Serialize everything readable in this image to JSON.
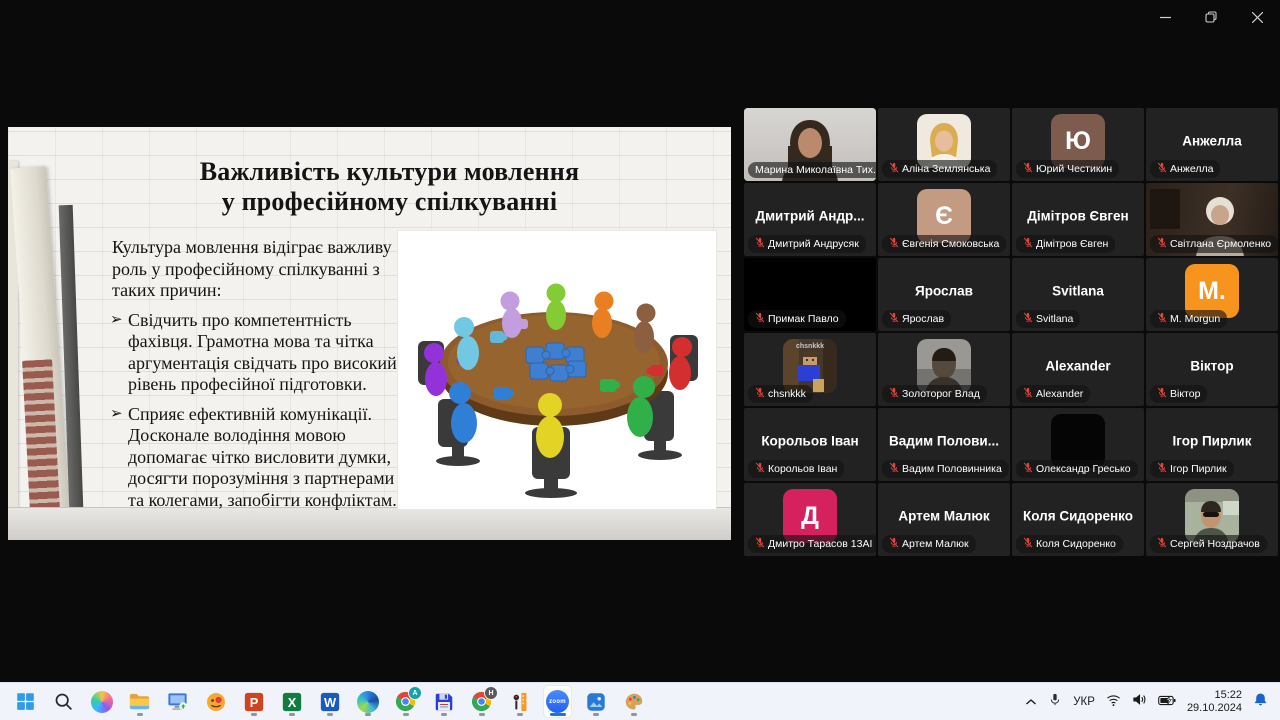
{
  "window": {
    "controls": [
      {
        "id": "minimize"
      },
      {
        "id": "restore"
      },
      {
        "id": "close"
      }
    ]
  },
  "slide": {
    "title_line1": "Важливість культури мовлення",
    "title_line2": "у професійному спілкуванні",
    "intro": "Культура мовлення відіграє важливу роль у професійному спілкуванні з таких причин:",
    "bullet_char": "➢",
    "bullets": [
      "Свідчить про компетентність фахівця. Грамотна мова та чітка аргументація свідчать про високий рівень професійної підготовки.",
      "Сприяє ефективній комунікації. Досконале володіння мовою допомагає чітко висловити думки, досягти порозуміння з партнерами та колегами, запобігти конфліктам."
    ],
    "image_description": "colorful-figures-around-round-table-with-puzzle-pieces"
  },
  "accent": {
    "active_speaker_border": "#21d065",
    "mute_red": "#e0463c"
  },
  "participants": [
    {
      "name": "Марина Миколаївна Тих...",
      "display": "",
      "visual": "video-marina",
      "muted": false,
      "active": true
    },
    {
      "name": "Аліна Землянська",
      "display": "",
      "visual": "photo-alina",
      "muted": true,
      "active": false
    },
    {
      "name": "Юрий Честикин",
      "display": "",
      "visual": "letter",
      "letter": "Ю",
      "color": "#7d5c4e",
      "muted": true,
      "active": false
    },
    {
      "name": "Анжелла",
      "display": "Анжелла",
      "visual": "name",
      "muted": true,
      "active": false
    },
    {
      "name": "Дмитрий Андрусяк",
      "display": "Дмитрий Андр...",
      "visual": "name",
      "muted": true,
      "active": false
    },
    {
      "name": "Євгенія Смоковська",
      "display": "",
      "visual": "letter",
      "letter": "Є",
      "color": "#c39a82",
      "muted": true,
      "active": false
    },
    {
      "name": "Дімітров Євген",
      "display": "Дімітров Євген",
      "visual": "name",
      "muted": true,
      "active": false
    },
    {
      "name": "Світлана Єрмоленко",
      "display": "",
      "visual": "video-svitlana",
      "muted": true,
      "active": false
    },
    {
      "name": "Примак Павло",
      "display": "",
      "visual": "black-video",
      "muted": true,
      "active": false
    },
    {
      "name": "Ярослав",
      "display": "Ярослав",
      "visual": "name",
      "muted": true,
      "active": false
    },
    {
      "name": "Svitlana",
      "display": "Svitlana",
      "visual": "name",
      "muted": true,
      "active": false
    },
    {
      "name": "M. Morgun",
      "display": "",
      "visual": "letter",
      "letter": "M.",
      "color": "#f7941e",
      "muted": true,
      "active": false
    },
    {
      "name": "chsnkkk",
      "display": "",
      "visual": "photo-minecraft",
      "overlay": "chsnkkk",
      "muted": true,
      "active": false
    },
    {
      "name": "Золоторог Влад",
      "display": "",
      "visual": "photo-vlad",
      "muted": true,
      "active": false
    },
    {
      "name": "Alexander",
      "display": "Alexander",
      "visual": "name",
      "muted": true,
      "active": false
    },
    {
      "name": "Віктор",
      "display": "Віктор",
      "visual": "name",
      "muted": true,
      "active": false
    },
    {
      "name": "Корольов Іван",
      "display": "Корольов Іван",
      "visual": "name",
      "muted": true,
      "active": false
    },
    {
      "name": "Вадим Половинника",
      "display": "Вадим Полови...",
      "visual": "name",
      "muted": true,
      "active": false
    },
    {
      "name": "Олександр Гресько",
      "display": "",
      "visual": "photo-black",
      "muted": true,
      "active": false
    },
    {
      "name": "Ігор Пирлик",
      "display": "Ігор Пирлик",
      "visual": "name",
      "muted": true,
      "active": false
    },
    {
      "name": "Дмитро Тарасов 13АІ",
      "display": "",
      "visual": "letter",
      "letter": "Д",
      "color": "#d6215f",
      "muted": true,
      "active": false
    },
    {
      "name": "Артем Малюк",
      "display": "Артем Малюк",
      "visual": "name",
      "muted": true,
      "active": false
    },
    {
      "name": "Коля Сидоренко",
      "display": "Коля Сидоренко",
      "visual": "name",
      "muted": true,
      "active": false
    },
    {
      "name": "Сергей Ноздрачов",
      "display": "",
      "visual": "photo-sergey",
      "muted": true,
      "active": false
    }
  ],
  "taskbar": {
    "icons": [
      {
        "id": "start",
        "running": false,
        "active": false
      },
      {
        "id": "search",
        "running": false,
        "active": false
      },
      {
        "id": "copilot",
        "running": false,
        "active": false
      },
      {
        "id": "file-explorer",
        "running": true,
        "active": false
      },
      {
        "id": "this-pc",
        "running": false,
        "active": false
      },
      {
        "id": "image-viewer",
        "running": false,
        "active": false
      },
      {
        "id": "powerpoint",
        "running": true,
        "active": false
      },
      {
        "id": "excel",
        "running": true,
        "active": false
      },
      {
        "id": "word",
        "running": true,
        "active": false
      },
      {
        "id": "edge",
        "running": true,
        "active": false
      },
      {
        "id": "chrome-profile",
        "badge": "A",
        "running": true,
        "active": false
      },
      {
        "id": "save-app",
        "running": true,
        "active": false
      },
      {
        "id": "chrome-profile",
        "badge": "H",
        "running": true,
        "active": false
      },
      {
        "id": "education-app",
        "running": true,
        "active": false
      },
      {
        "id": "zoom",
        "running": true,
        "active": true
      },
      {
        "id": "photos",
        "running": true,
        "active": false
      },
      {
        "id": "paint",
        "running": true,
        "active": false
      }
    ],
    "tray": {
      "language": "УКР",
      "time": "15:22",
      "date": "29.10.2024"
    }
  }
}
